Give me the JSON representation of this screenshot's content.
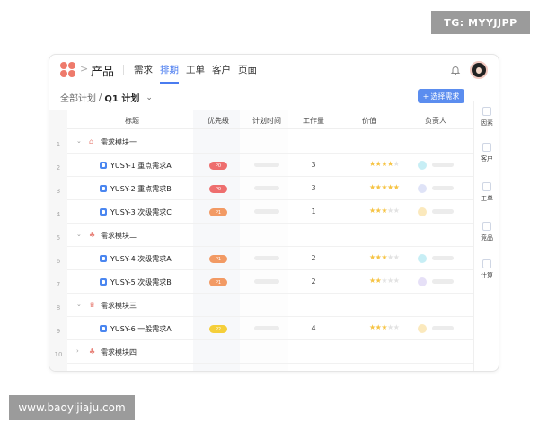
{
  "watermarks": {
    "top": "TG: MYYJJPP",
    "bottom": "www.baoyijiaju.com"
  },
  "nav": {
    "product": "产品",
    "separator": ">",
    "tabs": [
      {
        "label": "需求",
        "active": false
      },
      {
        "label": "排期",
        "active": true
      },
      {
        "label": "工单",
        "active": false
      },
      {
        "label": "客户",
        "active": false
      },
      {
        "label": "页面",
        "active": false
      }
    ]
  },
  "breadcrumb": {
    "root": "全部计划",
    "sep": "/",
    "current": "Q1 计划",
    "chevron": "⌄"
  },
  "select_button": {
    "icon": "+",
    "label": "选择需求"
  },
  "side_panel": [
    {
      "label": "因素",
      "icon": "factor-icon"
    },
    {
      "label": "客户",
      "icon": "customer-icon"
    },
    {
      "label": "工单",
      "icon": "ticket-icon"
    },
    {
      "label": "竞品",
      "icon": "competitor-icon"
    },
    {
      "label": "计算",
      "icon": "calc-icon"
    }
  ],
  "table": {
    "headers": [
      "标题",
      "优先级",
      "计划时间",
      "工作量",
      "价值",
      "负责人"
    ],
    "row_numbers": [
      "1",
      "2",
      "3",
      "4",
      "5",
      "6",
      "7",
      "8",
      "9",
      "10"
    ],
    "rows": [
      {
        "kind": "group",
        "toggle": "⌄",
        "icon": "⌂",
        "icon_name": "house-icon",
        "icon_color": "#e8837a",
        "name": "需求模块一"
      },
      {
        "kind": "task",
        "name": "YUSY-1  重点需求A",
        "priority": "P0",
        "priority_color": "#ee6e6e",
        "effort": "3",
        "value": 4,
        "assignee_color": "#c7eef5"
      },
      {
        "kind": "task",
        "name": "YUSY-2  重点需求B",
        "priority": "P0",
        "priority_color": "#ee6e6e",
        "effort": "3",
        "value": 5,
        "assignee_color": "#dfe3f7"
      },
      {
        "kind": "task",
        "name": "YUSY-3  次级需求C",
        "priority": "P1",
        "priority_color": "#f29a64",
        "effort": "1",
        "value": 3,
        "assignee_color": "#fbe9bd"
      },
      {
        "kind": "group",
        "toggle": "⌄",
        "icon": "♣",
        "icon_name": "cluster-icon",
        "icon_color": "#e8837a",
        "name": "需求模块二"
      },
      {
        "kind": "task",
        "name": "YUSY-4  次级需求A",
        "priority": "P1",
        "priority_color": "#f29a64",
        "effort": "2",
        "value": 3,
        "assignee_color": "#c7eef5"
      },
      {
        "kind": "task",
        "name": "YUSY-5  次级需求B",
        "priority": "P1",
        "priority_color": "#f29a64",
        "effort": "2",
        "value": 2,
        "assignee_color": "#e6e0f7"
      },
      {
        "kind": "group",
        "toggle": "⌄",
        "icon": "♛",
        "icon_name": "crown-icon",
        "icon_color": "#e8837a",
        "name": "需求模块三"
      },
      {
        "kind": "task",
        "name": "YUSY-6  一般需求A",
        "priority": "P2",
        "priority_color": "#f5cf3a",
        "effort": "4",
        "value": 3,
        "assignee_color": "#fbe9bd"
      },
      {
        "kind": "group",
        "toggle": "›",
        "icon": "♣",
        "icon_name": "cluster-icon",
        "icon_color": "#e8837a",
        "name": "需求模块四"
      }
    ]
  },
  "colors": {
    "accent": "#4a7cf0",
    "button": "#5b8def",
    "star_on": "#f6c342",
    "star_off": "#e2e2e2"
  }
}
